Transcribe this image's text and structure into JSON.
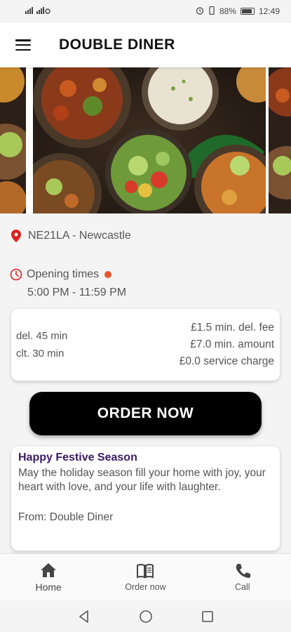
{
  "status_bar": {
    "signal_text": "ull ull",
    "battery_percent": "88%",
    "time": "12:49"
  },
  "app_bar": {
    "title": "DOUBLE DINER",
    "menu_icon": "hamburger-menu-icon"
  },
  "location": {
    "icon": "map-pin-icon",
    "text": "NE21LA - Newcastle",
    "icon_color": "#e02020"
  },
  "opening": {
    "icon": "clock-icon",
    "label": "Opening times",
    "hours": "5:00 PM - 11:59 PM",
    "status_color": "#e8552b"
  },
  "delivery_info": {
    "delivery_time": "del. 45 min",
    "collection_time": "clt. 30 min",
    "min_delivery_fee": "£1.5 min. del. fee",
    "min_amount": "£7.0 min. amount",
    "service_charge": "£0.0 service charge"
  },
  "order_button": {
    "label": "ORDER NOW"
  },
  "announcement": {
    "title": "Happy Festive Season",
    "body": "May the holiday season fill your home with joy, your heart with love, and your life with laughter.",
    "from": "From: Double Diner",
    "title_color": "#3a1a66"
  },
  "bottom_nav": {
    "items": [
      {
        "label": "Home",
        "icon": "home-icon"
      },
      {
        "label": "Order now",
        "icon": "menu-book-icon"
      },
      {
        "label": "Call",
        "icon": "phone-icon"
      }
    ]
  }
}
